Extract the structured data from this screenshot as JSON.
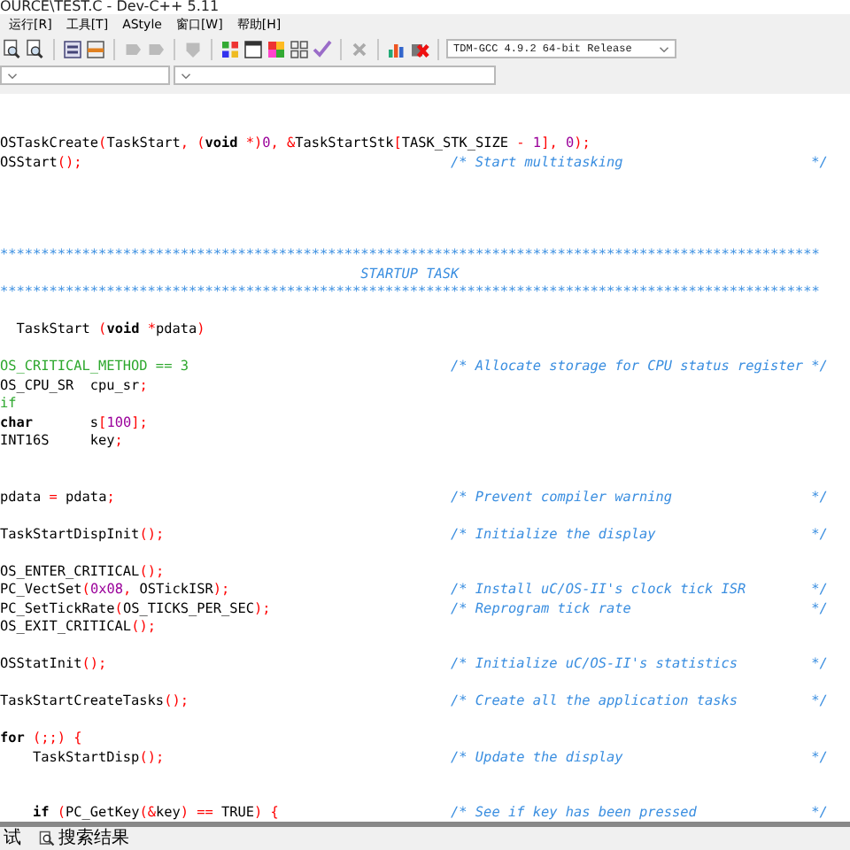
{
  "window": {
    "title": "OURCE\\TEST.C - Dev-C++ 5.11"
  },
  "menu": [
    "运行[R]",
    "工具[T]",
    "AStyle",
    "窗口[W]",
    "帮助[H]"
  ],
  "compiler": {
    "value": "TDM-GCC 4.9.2 64-bit Release"
  },
  "editor": {
    "lines": [
      {
        "kind": "blank"
      },
      {
        "kind": "blank"
      },
      {
        "kind": "code",
        "tokens": [
          {
            "kind": "plain",
            "text": "OSTaskCreate"
          },
          {
            "kind": "punct",
            "text": "("
          },
          {
            "kind": "plain",
            "text": "TaskStart"
          },
          {
            "kind": "punct",
            "text": ", ("
          },
          {
            "kind": "keyword",
            "text": "void"
          },
          {
            "kind": "punct",
            "text": " *)"
          },
          {
            "kind": "number",
            "text": "0"
          },
          {
            "kind": "punct",
            "text": ", &"
          },
          {
            "kind": "plain",
            "text": "TaskStartStk"
          },
          {
            "kind": "punct",
            "text": "["
          },
          {
            "kind": "plain",
            "text": "TASK_STK_SIZE"
          },
          {
            "kind": "punct",
            "text": " - "
          },
          {
            "kind": "number",
            "text": "1"
          },
          {
            "kind": "punct",
            "text": "], "
          },
          {
            "kind": "number",
            "text": "0"
          },
          {
            "kind": "punct",
            "text": ");"
          }
        ]
      },
      {
        "kind": "code",
        "tokens": [
          {
            "kind": "plain",
            "text": "OSStart"
          },
          {
            "kind": "punct",
            "text": "();"
          }
        ],
        "comment": "/* Start multitasking",
        "comment_end": "*/"
      },
      {
        "kind": "blank"
      },
      {
        "kind": "blank"
      },
      {
        "kind": "blank"
      },
      {
        "kind": "blank"
      },
      {
        "kind": "stars",
        "text": "****************************************************************************************************"
      },
      {
        "kind": "banner",
        "text": "STARTUP TASK"
      },
      {
        "kind": "stars",
        "text": "****************************************************************************************************"
      },
      {
        "kind": "blank"
      },
      {
        "kind": "code",
        "tokens": [
          {
            "kind": "plain",
            "text": "  TaskStart "
          },
          {
            "kind": "punct",
            "text": "("
          },
          {
            "kind": "keyword",
            "text": "void"
          },
          {
            "kind": "punct",
            "text": " *"
          },
          {
            "kind": "plain",
            "text": "pdata"
          },
          {
            "kind": "punct",
            "text": ")"
          }
        ]
      },
      {
        "kind": "blank"
      },
      {
        "kind": "code",
        "tokens": [
          {
            "kind": "preproc",
            "text": "OS_CRITICAL_METHOD == 3"
          }
        ],
        "comment": "/* Allocate storage for CPU status register",
        "comment_end": "*/"
      },
      {
        "kind": "code",
        "tokens": [
          {
            "kind": "plain",
            "text": "OS_CPU_SR  cpu_sr"
          },
          {
            "kind": "punct",
            "text": ";"
          }
        ]
      },
      {
        "kind": "code",
        "tokens": [
          {
            "kind": "preproc",
            "text": "if"
          }
        ]
      },
      {
        "kind": "code",
        "tokens": [
          {
            "kind": "keyword",
            "text": "char"
          },
          {
            "kind": "plain",
            "text": "       s"
          },
          {
            "kind": "punct",
            "text": "["
          },
          {
            "kind": "number",
            "text": "100"
          },
          {
            "kind": "punct",
            "text": "];"
          }
        ]
      },
      {
        "kind": "code",
        "tokens": [
          {
            "kind": "plain",
            "text": "INT16S     key"
          },
          {
            "kind": "punct",
            "text": ";"
          }
        ]
      },
      {
        "kind": "blank"
      },
      {
        "kind": "blank"
      },
      {
        "kind": "code",
        "tokens": [
          {
            "kind": "plain",
            "text": "pdata "
          },
          {
            "kind": "punct",
            "text": "="
          },
          {
            "kind": "plain",
            "text": " pdata"
          },
          {
            "kind": "punct",
            "text": ";"
          }
        ],
        "comment": "/* Prevent compiler warning",
        "comment_end": "*/"
      },
      {
        "kind": "blank"
      },
      {
        "kind": "code",
        "tokens": [
          {
            "kind": "plain",
            "text": "TaskStartDispInit"
          },
          {
            "kind": "punct",
            "text": "();"
          }
        ],
        "comment": "/* Initialize the display",
        "comment_end": "*/"
      },
      {
        "kind": "blank"
      },
      {
        "kind": "code",
        "tokens": [
          {
            "kind": "plain",
            "text": "OS_ENTER_CRITICAL"
          },
          {
            "kind": "punct",
            "text": "();"
          }
        ]
      },
      {
        "kind": "code",
        "tokens": [
          {
            "kind": "plain",
            "text": "PC_VectSet"
          },
          {
            "kind": "punct",
            "text": "("
          },
          {
            "kind": "number",
            "text": "0x08"
          },
          {
            "kind": "punct",
            "text": ", "
          },
          {
            "kind": "plain",
            "text": "OSTickISR"
          },
          {
            "kind": "punct",
            "text": ");"
          }
        ],
        "comment": "/* Install uC/OS-II's clock tick ISR",
        "comment_end": "*/"
      },
      {
        "kind": "code",
        "tokens": [
          {
            "kind": "plain",
            "text": "PC_SetTickRate"
          },
          {
            "kind": "punct",
            "text": "("
          },
          {
            "kind": "plain",
            "text": "OS_TICKS_PER_SEC"
          },
          {
            "kind": "punct",
            "text": ");"
          }
        ],
        "comment": "/* Reprogram tick rate",
        "comment_end": "*/"
      },
      {
        "kind": "code",
        "tokens": [
          {
            "kind": "plain",
            "text": "OS_EXIT_CRITICAL"
          },
          {
            "kind": "punct",
            "text": "();"
          }
        ]
      },
      {
        "kind": "blank"
      },
      {
        "kind": "code",
        "tokens": [
          {
            "kind": "plain",
            "text": "OSStatInit"
          },
          {
            "kind": "punct",
            "text": "();"
          }
        ],
        "comment": "/* Initialize uC/OS-II's statistics",
        "comment_end": "*/"
      },
      {
        "kind": "blank"
      },
      {
        "kind": "code",
        "tokens": [
          {
            "kind": "plain",
            "text": "TaskStartCreateTasks"
          },
          {
            "kind": "punct",
            "text": "();"
          }
        ],
        "comment": "/* Create all the application tasks",
        "comment_end": "*/"
      },
      {
        "kind": "blank"
      },
      {
        "kind": "code",
        "tokens": [
          {
            "kind": "keyword",
            "text": "for"
          },
          {
            "kind": "punct",
            "text": " (;;) {"
          }
        ]
      },
      {
        "kind": "code",
        "tokens": [
          {
            "kind": "plain",
            "text": "    TaskStartDisp"
          },
          {
            "kind": "punct",
            "text": "();"
          }
        ],
        "comment": "/* Update the display",
        "comment_end": "*/"
      },
      {
        "kind": "blank"
      },
      {
        "kind": "blank"
      },
      {
        "kind": "code",
        "tokens": [
          {
            "kind": "keyword",
            "text": "    if"
          },
          {
            "kind": "punct",
            "text": " ("
          },
          {
            "kind": "plain",
            "text": "PC_GetKey"
          },
          {
            "kind": "punct",
            "text": "(&"
          },
          {
            "kind": "plain",
            "text": "key"
          },
          {
            "kind": "punct",
            "text": ") == "
          },
          {
            "kind": "plain",
            "text": "TRUE"
          },
          {
            "kind": "punct",
            "text": ") {"
          }
        ],
        "comment": "/* See if key has been pressed",
        "comment_end": "*/"
      }
    ]
  },
  "bottom_tabs": [
    {
      "label": "试",
      "selected": false
    },
    {
      "label": "搜索结果",
      "selected": false
    }
  ]
}
